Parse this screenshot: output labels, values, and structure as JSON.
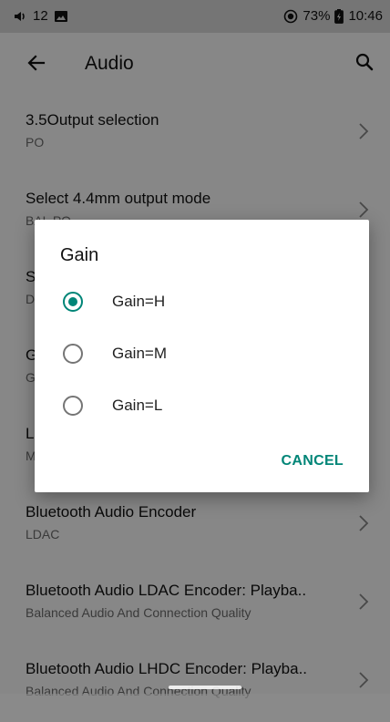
{
  "status_bar": {
    "volume_level": "12",
    "battery": "73%",
    "time": "10:46"
  },
  "app_bar": {
    "title": "Audio"
  },
  "settings": [
    {
      "title": "3.5Output selection",
      "subtitle": "PO"
    },
    {
      "title": "Select 4.4mm output mode",
      "subtitle": "BAL PO"
    },
    {
      "title": "S",
      "subtitle": "D"
    },
    {
      "title": "G",
      "subtitle": "G"
    },
    {
      "title": "L",
      "subtitle": "M"
    },
    {
      "title": "Bluetooth Audio Encoder",
      "subtitle": "LDAC"
    },
    {
      "title": "Bluetooth Audio LDAC Encoder: Playba..",
      "subtitle": "Balanced Audio And Connection Quality"
    },
    {
      "title": "Bluetooth Audio LHDC Encoder: Playba..",
      "subtitle": "Balanced Audio And Connection Quality"
    }
  ],
  "dialog": {
    "title": "Gain",
    "options": [
      {
        "label": "Gain=H",
        "selected": true
      },
      {
        "label": "Gain=M",
        "selected": false
      },
      {
        "label": "Gain=L",
        "selected": false
      }
    ],
    "cancel_label": "CANCEL"
  },
  "colors": {
    "accent": "#008577",
    "scrim": "rgba(0,0,0,0.47)"
  }
}
